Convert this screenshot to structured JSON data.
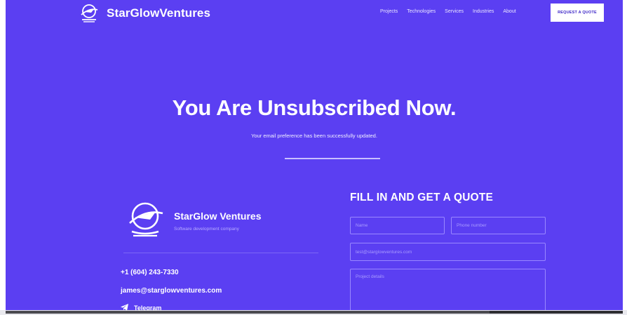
{
  "header": {
    "brand": "StarGlowVentures",
    "nav": [
      "Projects",
      "Technologies",
      "Services",
      "Industries",
      "About"
    ],
    "cta": "REQUEST A QUOTE"
  },
  "hero": {
    "title": "You Are Unsubscribed Now.",
    "subtitle": "Your email preference has been successfully updated."
  },
  "company": {
    "name": "StarGlow Ventures",
    "tagline": "Software development company",
    "phone": "+1 (604) 243-7330",
    "email": "james@starglowventures.com",
    "telegram": "Telegram"
  },
  "form": {
    "title": "FILL IN AND GET A QUOTE",
    "name_placeholder": "Name",
    "phone_placeholder": "Phone number",
    "email_placeholder": "test@starglowventures.com",
    "details_placeholder": "Project details"
  },
  "colors": {
    "background": "#5b3ff2",
    "button_bg": "#ffffff",
    "button_text": "#3b25c7"
  },
  "icons": [
    "rocket-globe-logo-icon",
    "telegram-icon"
  ]
}
